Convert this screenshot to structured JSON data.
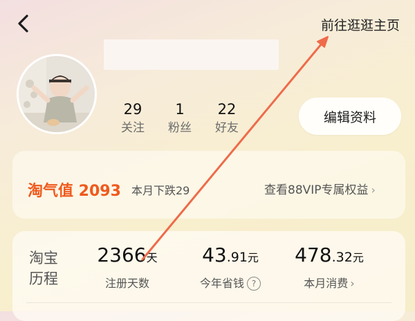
{
  "header": {
    "back_icon": "chevron-left-icon",
    "homepage_link": "前往逛逛主页"
  },
  "profile": {
    "avatar_icon": "baby-avatar-photo",
    "stats": [
      {
        "value": "29",
        "label": "关注"
      },
      {
        "value": "1",
        "label": "粉丝"
      },
      {
        "value": "22",
        "label": "好友"
      }
    ],
    "edit_button": "编辑资料"
  },
  "taoqi": {
    "label": "淘气值 2093",
    "change": "本月下跌29",
    "vip_link": "查看88VIP专属权益",
    "vip_chevron": "›"
  },
  "history": {
    "title_line1": "淘宝",
    "title_line2": "历程",
    "metrics": [
      {
        "int": "2366",
        "frac": "",
        "unit": "天",
        "label": "注册天数"
      },
      {
        "int": "43",
        "frac": ".91",
        "unit": "元",
        "label": "今年省钱",
        "help_icon": "?"
      },
      {
        "int": "478",
        "frac": ".32",
        "unit": "元",
        "label": "本月消费",
        "chevron": "›"
      }
    ]
  },
  "colors": {
    "accent_orange": "#ef5a1d",
    "annotation_arrow": "#ee6b4a"
  }
}
